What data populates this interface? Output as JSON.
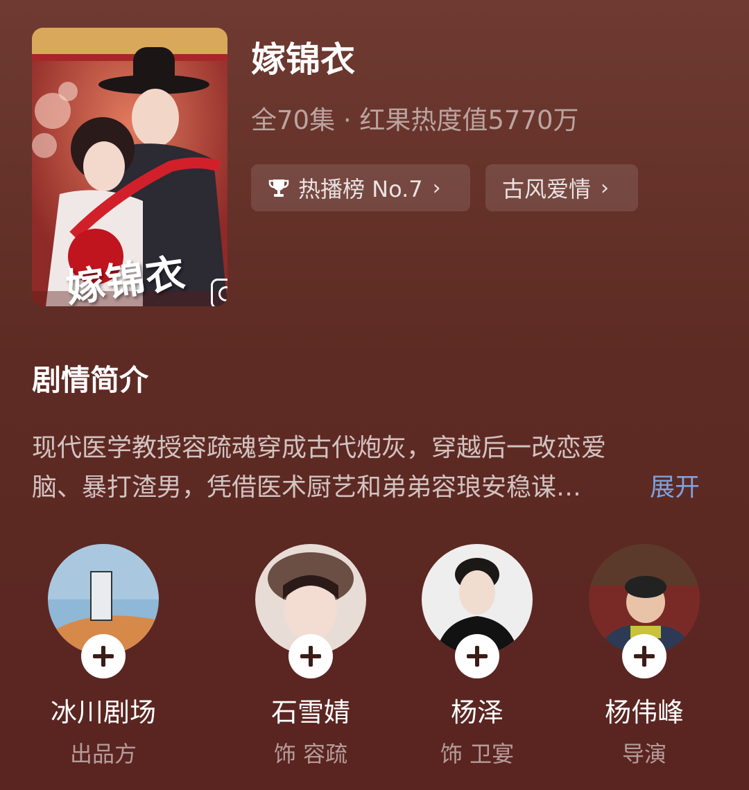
{
  "drama": {
    "title": "嫁锦衣",
    "meta": "全70集 · 红果热度值5770万",
    "poster_title": "嫁锦衣"
  },
  "tags": [
    {
      "label": "热播榜 No.7",
      "icon": "trophy-icon"
    },
    {
      "label": "古风爱情"
    }
  ],
  "synopsis": {
    "heading": "剧情简介",
    "line1": "现代医学教授容疏魂穿成古代炮灰，穿越后一改恋爱",
    "line2": "脑、暴打渣男，凭借医术厨艺和弟弟容琅安稳谋…",
    "expand": "展开"
  },
  "people": [
    {
      "name": "冰川剧场",
      "role": "出品方"
    },
    {
      "name": "石雪婧",
      "role": "饰 容疏"
    },
    {
      "name": "杨泽",
      "role": "饰 卫宴"
    },
    {
      "name": "杨伟峰",
      "role": "导演"
    }
  ],
  "colors": {
    "background": "#5e2b24",
    "link": "#7ea2dc"
  }
}
